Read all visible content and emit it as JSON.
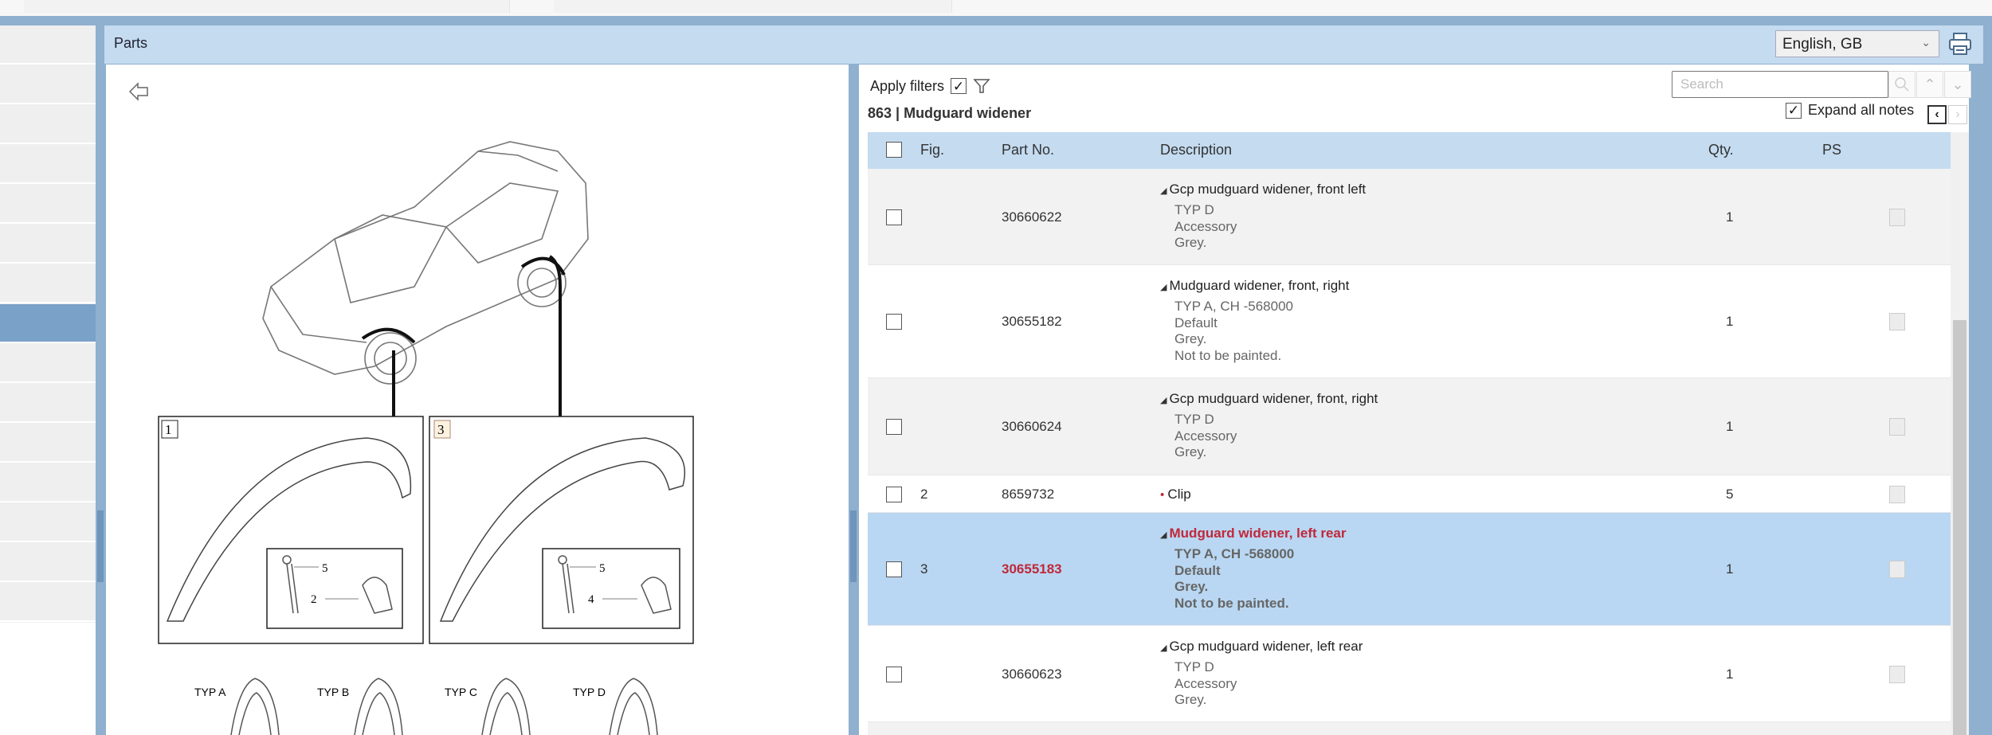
{
  "header": {
    "title": "Parts",
    "language": "English, GB"
  },
  "filters": {
    "apply_label": "Apply filters",
    "apply_checked": true,
    "search_placeholder": "Search",
    "expand_label": "Expand all notes",
    "expand_checked": true
  },
  "group": {
    "code": "863",
    "name": "Mudguard widener",
    "display": "863  |  Mudguard widener"
  },
  "table": {
    "headers": {
      "fig": "Fig.",
      "part_no": "Part No.",
      "description": "Description",
      "qty": "Qty.",
      "ps": "PS"
    },
    "rows": [
      {
        "fig": "",
        "part_no": "30660622",
        "title": "Gcp mudguard widener, front left",
        "marker": "triangle",
        "notes": [
          "TYP D",
          "Accessory",
          "Grey."
        ],
        "qty": "1",
        "selected": false
      },
      {
        "fig": "",
        "part_no": "30655182",
        "title": "Mudguard widener, front, right",
        "marker": "triangle",
        "notes": [
          "TYP A, CH -568000",
          "Default",
          "Grey.",
          "Not to be painted."
        ],
        "qty": "1",
        "selected": false
      },
      {
        "fig": "",
        "part_no": "30660624",
        "title": "Gcp mudguard widener, front, right",
        "marker": "triangle",
        "notes": [
          "TYP D",
          "Accessory",
          "Grey."
        ],
        "qty": "1",
        "selected": false
      },
      {
        "fig": "2",
        "part_no": "8659732",
        "title": "Clip",
        "marker": "bullet",
        "notes": [],
        "qty": "5",
        "selected": false
      },
      {
        "fig": "3",
        "part_no": "30655183",
        "title": "Mudguard widener, left rear",
        "marker": "triangle",
        "notes": [
          "TYP A, CH -568000",
          "Default",
          "Grey.",
          "Not to be painted."
        ],
        "qty": "1",
        "selected": true
      },
      {
        "fig": "",
        "part_no": "30660623",
        "title": "Gcp mudguard widener, left rear",
        "marker": "triangle",
        "notes": [
          "TYP D",
          "Accessory",
          "Grey."
        ],
        "qty": "1",
        "selected": false
      }
    ]
  },
  "diagram": {
    "callouts": [
      "1",
      "3"
    ],
    "inset1": [
      "5",
      "2"
    ],
    "inset2": [
      "5",
      "4"
    ],
    "types": [
      "TYP A",
      "TYP B",
      "TYP C",
      "TYP D"
    ]
  },
  "colors": {
    "header_bg": "#c4dbf0",
    "selected_row": "#b9d7f2",
    "selected_text": "#c0283a",
    "frame": "#8fb0cf"
  }
}
